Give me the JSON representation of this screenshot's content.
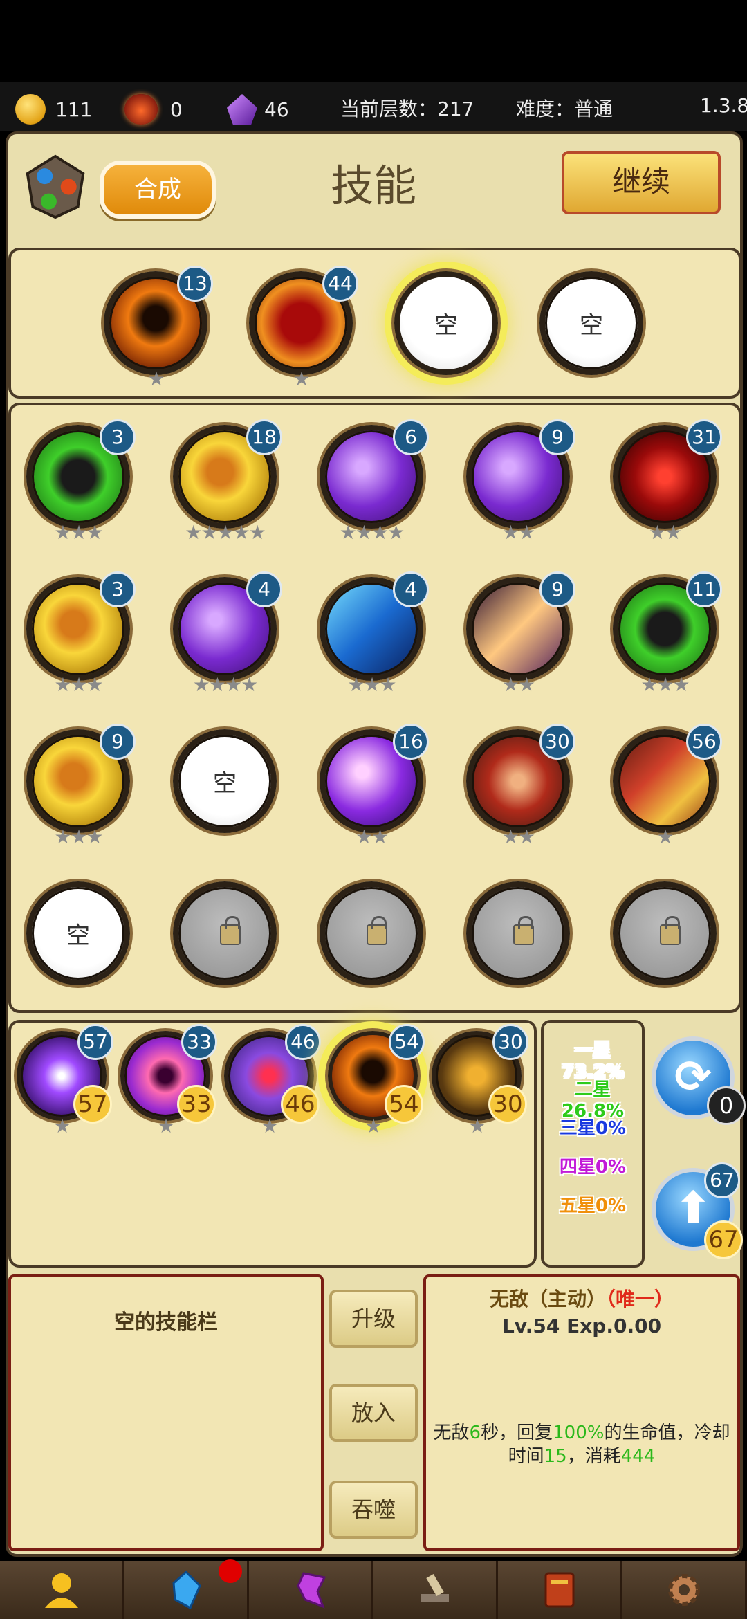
{
  "topbar": {
    "gold": "111",
    "bombs": "0",
    "crystals": "46",
    "floor": "当前层数：217",
    "difficulty": "难度：普通",
    "version": "1.3.8"
  },
  "header": {
    "synth_label": "合成",
    "title": "技能",
    "continue_label": "继续"
  },
  "equipped": [
    {
      "icon": "cross-icon",
      "level": "13",
      "stars": "★",
      "empty": false
    },
    {
      "icon": "flame-body-icon",
      "level": "44",
      "stars": "★",
      "empty": false
    },
    {
      "label": "空",
      "empty": true,
      "selected": true
    },
    {
      "label": "空",
      "empty": true
    }
  ],
  "inventory": [
    {
      "icon": "skull-icon",
      "level": "3",
      "stars": "★★★"
    },
    {
      "icon": "gold-scroll-icon",
      "level": "18",
      "stars": "★★★★★"
    },
    {
      "icon": "lightning-icon",
      "level": "6",
      "stars": "★★★★"
    },
    {
      "icon": "lightning-icon",
      "level": "9",
      "stars": "★★"
    },
    {
      "icon": "claw-icon",
      "level": "31",
      "stars": "★★"
    },
    {
      "icon": "gold-scroll-icon",
      "level": "3",
      "stars": "★★★"
    },
    {
      "icon": "lightning-icon",
      "level": "4",
      "stars": "★★★★"
    },
    {
      "icon": "blade-icon",
      "level": "4",
      "stars": "★★★"
    },
    {
      "icon": "streak-icon",
      "level": "9",
      "stars": "★★"
    },
    {
      "icon": "skull-icon",
      "level": "11",
      "stars": "★★★"
    },
    {
      "icon": "gold-scroll-icon",
      "level": "9",
      "stars": "★★★"
    },
    {
      "label": "空",
      "empty": true
    },
    {
      "icon": "star-orb-icon",
      "level": "16",
      "stars": "★★"
    },
    {
      "icon": "shield-icon",
      "level": "30",
      "stars": "★★"
    },
    {
      "icon": "banner-icon",
      "level": "56",
      "stars": "★"
    },
    {
      "label": "空",
      "empty": true
    },
    {
      "locked": true
    },
    {
      "locked": true
    },
    {
      "locked": true
    },
    {
      "locked": true
    }
  ],
  "draw_pool": [
    {
      "icon": "arc-icon",
      "level": "57",
      "cost": "57",
      "stars": "★"
    },
    {
      "icon": "eye-icon",
      "level": "33",
      "cost": "33",
      "stars": "★"
    },
    {
      "icon": "orb-icon",
      "level": "46",
      "cost": "46",
      "stars": "★"
    },
    {
      "icon": "cross-icon",
      "level": "54",
      "cost": "54",
      "stars": "★",
      "selected": true
    },
    {
      "icon": "ore-icon",
      "level": "30",
      "cost": "30",
      "stars": "★"
    }
  ],
  "rates": [
    {
      "label": "一星73.2%",
      "color": "#ffffff"
    },
    {
      "label": "二星26.8%",
      "color": "#2ecb1a"
    },
    {
      "label": "三星0%",
      "color": "#1a3ae0"
    },
    {
      "label": "四星0%",
      "color": "#c21ad8"
    },
    {
      "label": "五星0%",
      "color": "#f0900a"
    }
  ],
  "refresh": {
    "count": "0"
  },
  "upgrade_pool": {
    "level": "67",
    "cost": "67"
  },
  "left_info": {
    "title": "空的技能栏"
  },
  "actions": {
    "upgrade": "升级",
    "place": "放入",
    "devour": "吞噬"
  },
  "skill_info": {
    "name": "无敌（主动）",
    "unique": "（唯一）",
    "level": "Lv.54 Exp.0.00",
    "d1": "无敌",
    "d2": "6",
    "d3": "秒，回复",
    "d4": "100%",
    "d5": "的生命值，冷却时间",
    "d6": "15",
    "d7": "，消耗",
    "d8": "444"
  },
  "bottom_nav": [
    "hero-icon",
    "crystal-icon",
    "rune-icon",
    "forge-icon",
    "book-icon",
    "settings-gear-icon"
  ]
}
